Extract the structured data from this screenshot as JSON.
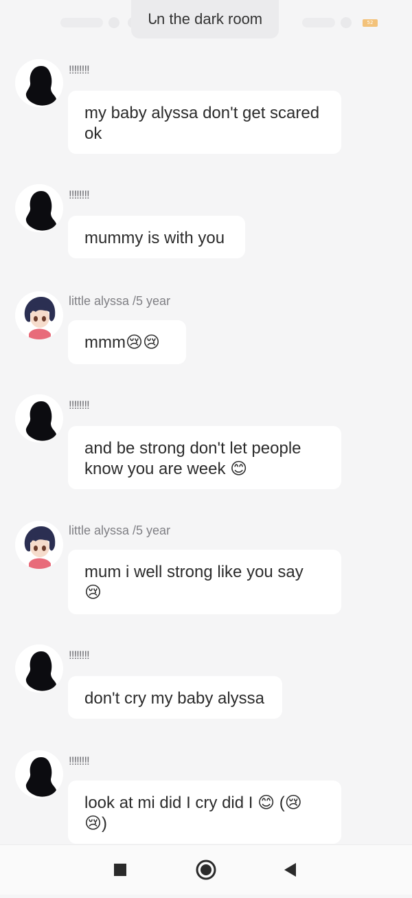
{
  "status_bar": {
    "battery_label": "52"
  },
  "header": {
    "title": "𐐢n the dark room"
  },
  "messages": [
    {
      "sender": "!!!!!!!!",
      "text": "my baby alyssa don't get scared ok",
      "avatar": "mother-silhouette"
    },
    {
      "sender": "!!!!!!!!",
      "text": "mummy is with you",
      "avatar": "mother-silhouette"
    },
    {
      "sender": "little alyssa /5 year",
      "text": "mmm😢😢",
      "avatar": "anime-girl"
    },
    {
      "sender": "!!!!!!!!",
      "text": "and be strong don't let people know you are week 😊",
      "avatar": "mother-silhouette"
    },
    {
      "sender": "little alyssa /5 year",
      "text": "mum i well strong like you say 😢",
      "avatar": "anime-girl"
    },
    {
      "sender": "!!!!!!!!",
      "text": "don't cry my baby alyssa",
      "avatar": "mother-silhouette"
    },
    {
      "sender": "!!!!!!!!",
      "text": "look at mi did I cry did I 😊 (😢 😢)",
      "avatar": "mother-silhouette"
    }
  ],
  "nav": {
    "buttons": [
      "recent-apps",
      "home",
      "back"
    ]
  },
  "colors": {
    "background": "#f5f5f6",
    "bubble": "#ffffff",
    "sender": "#7f7f84"
  }
}
